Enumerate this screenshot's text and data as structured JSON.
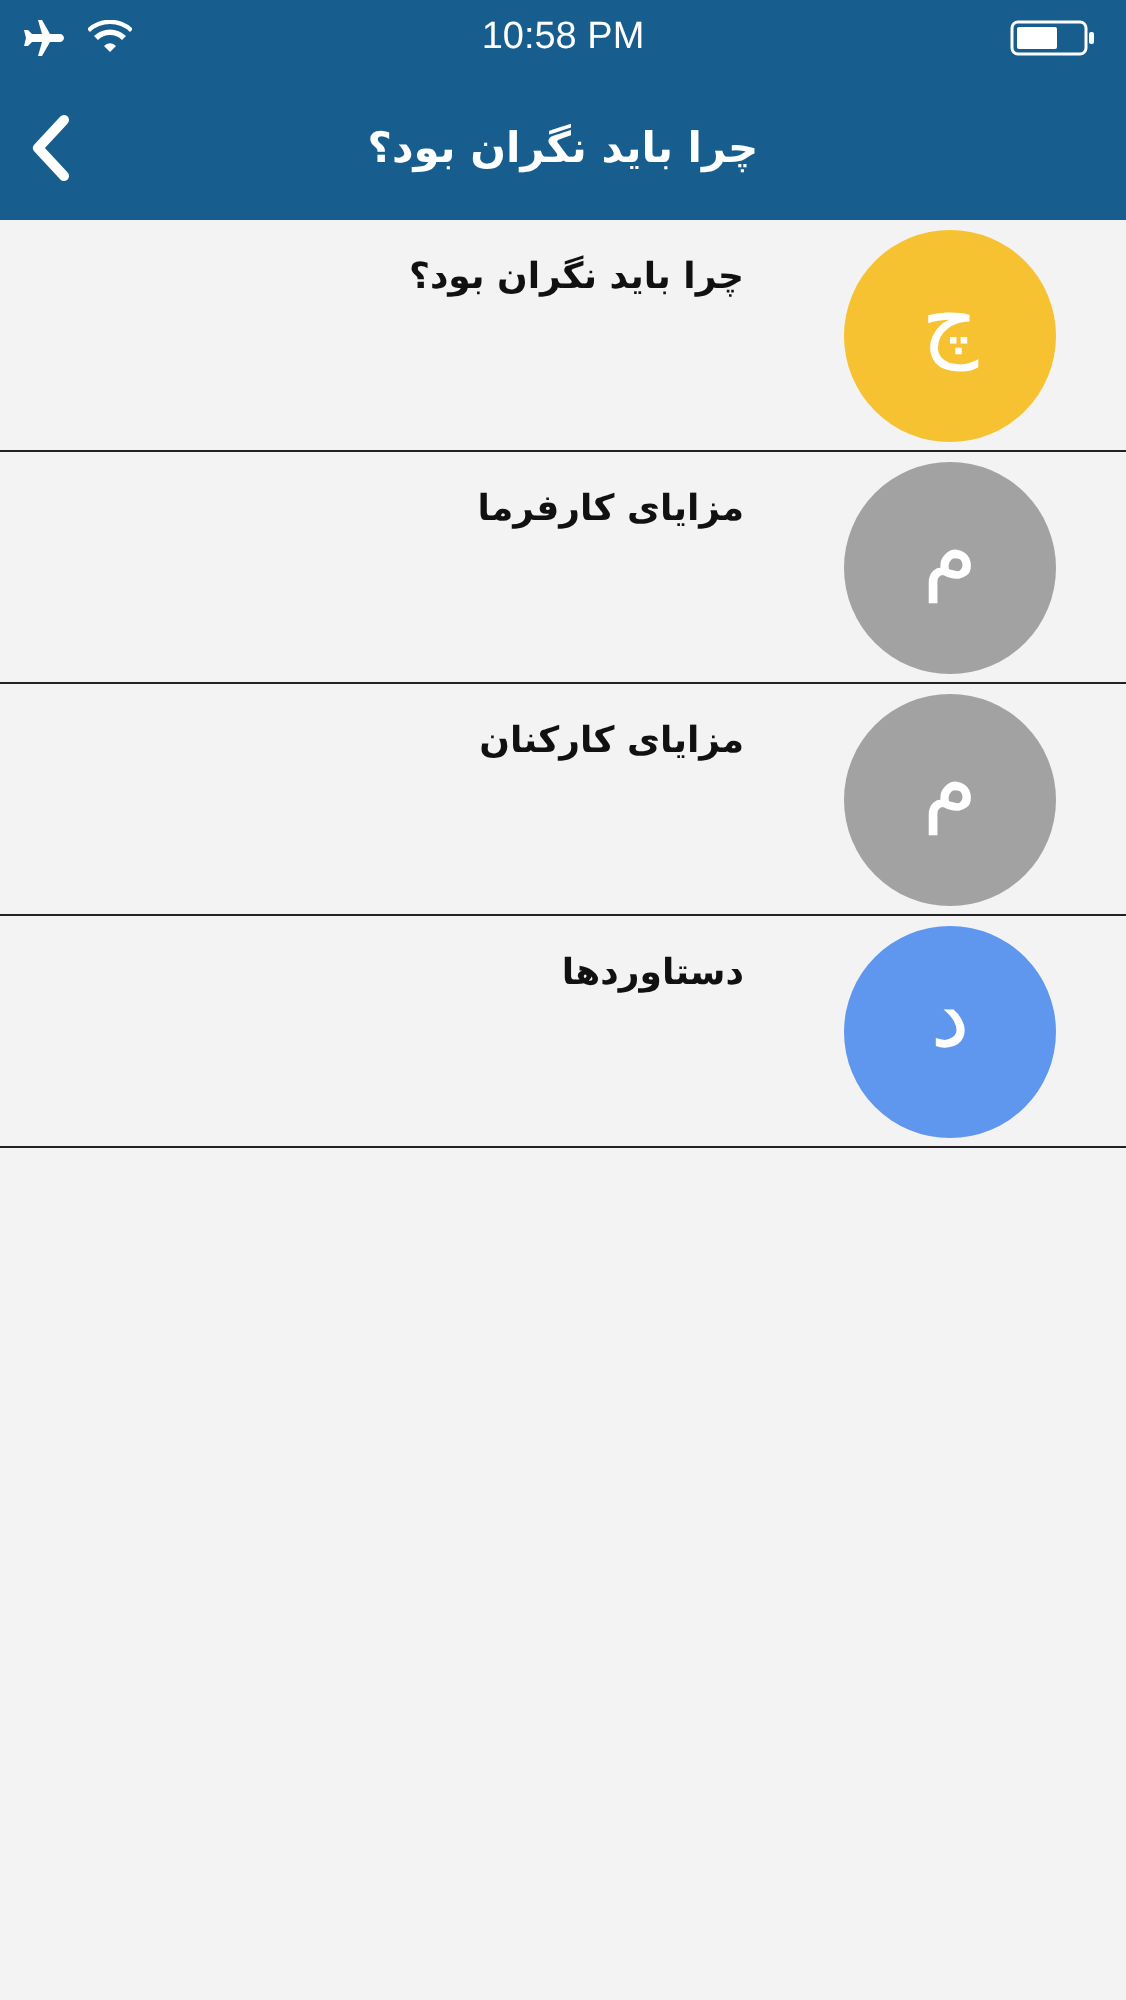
{
  "status_bar": {
    "time": "10:58 PM"
  },
  "header": {
    "title": "چرا باید نگران بود؟"
  },
  "items": [
    {
      "letter": "چ",
      "title": "چرا باید نگران بود؟",
      "color": "#f6c232"
    },
    {
      "letter": "م",
      "title": "مزایای کارفرما",
      "color": "#a2a2a2"
    },
    {
      "letter": "م",
      "title": "مزایای کارکنان",
      "color": "#a2a2a2"
    },
    {
      "letter": "د",
      "title": "دستاوردها",
      "color": "#5f97ee"
    }
  ]
}
